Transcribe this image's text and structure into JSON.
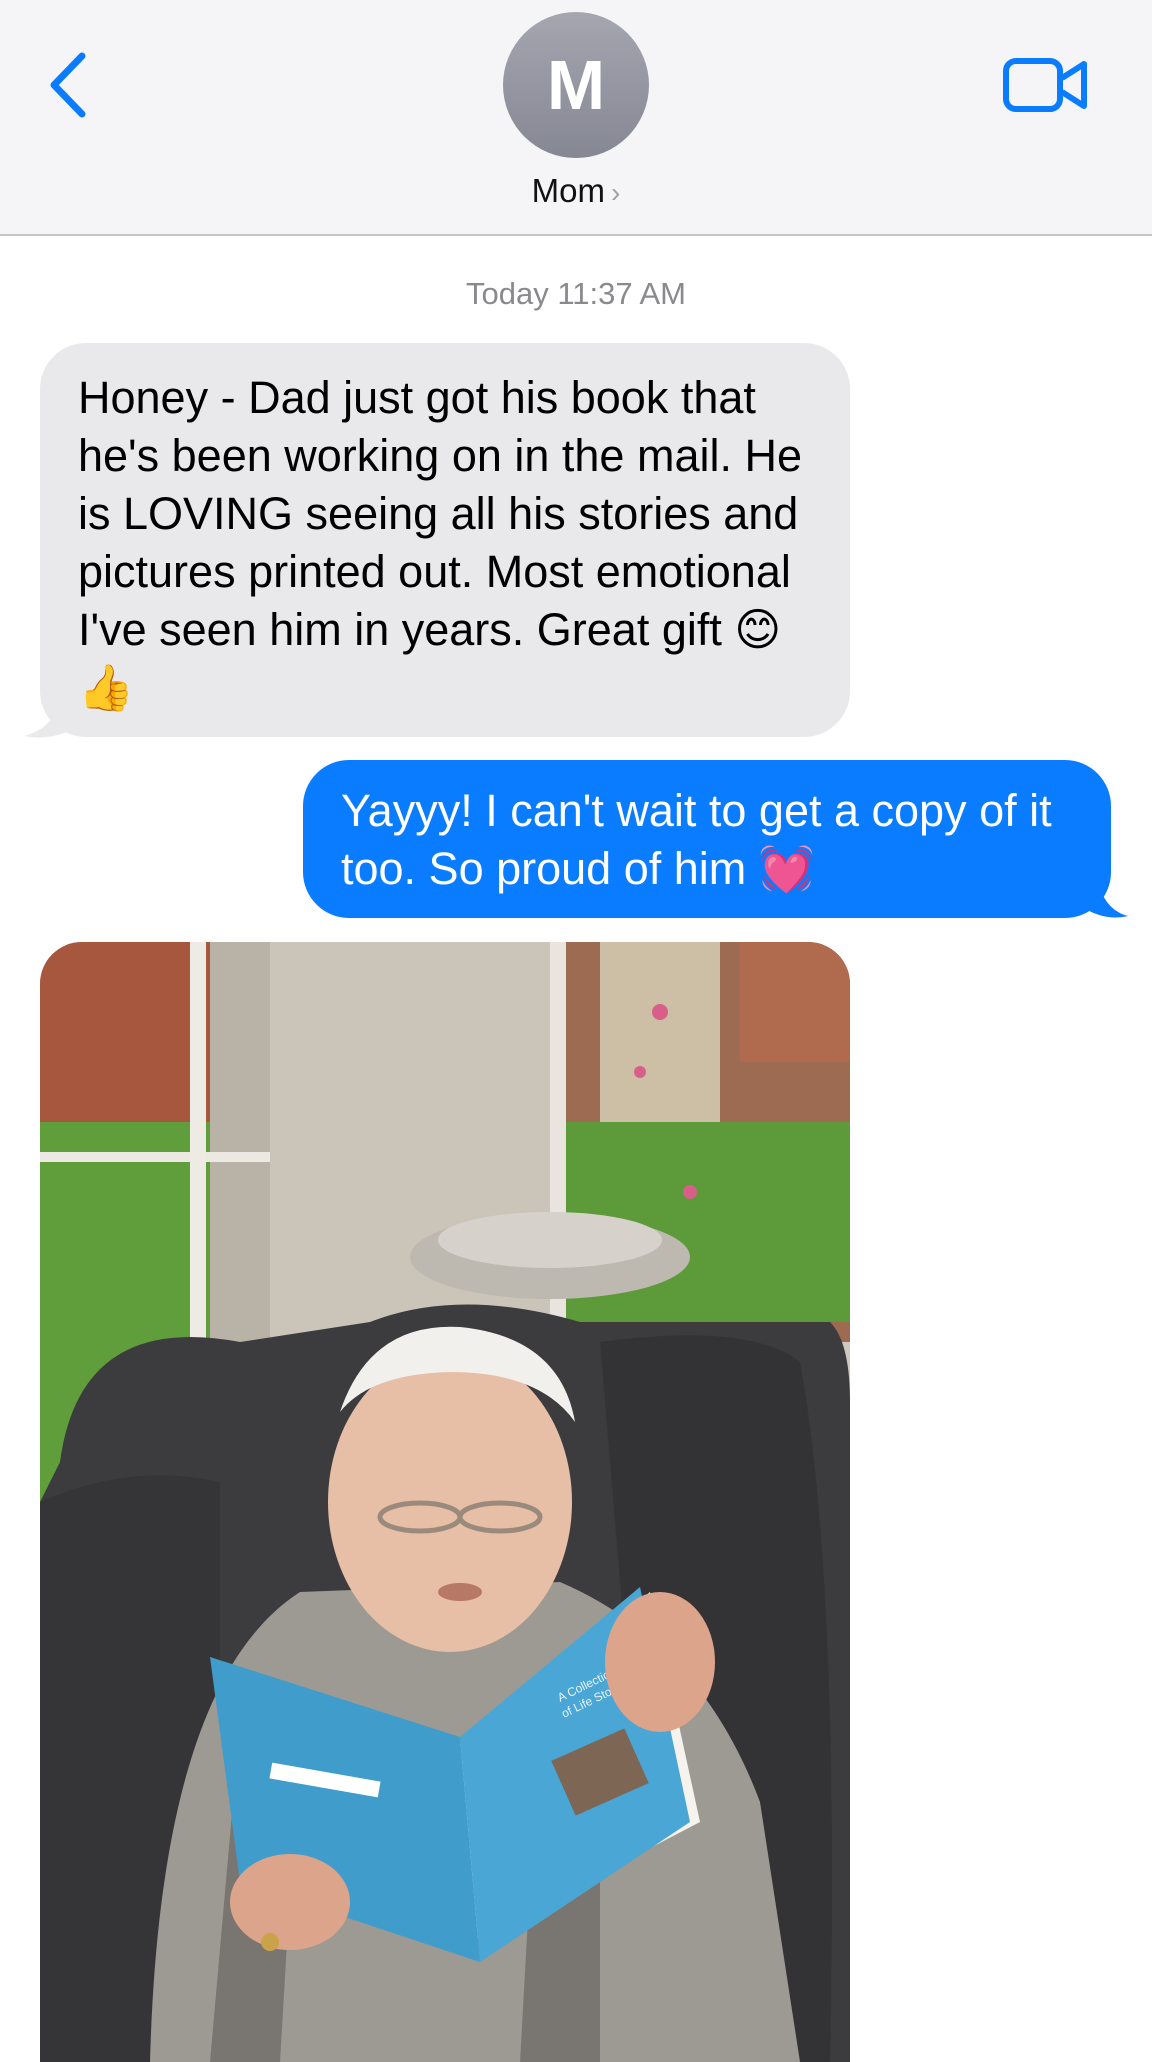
{
  "header": {
    "avatar_initial": "M",
    "contact_name": "Mom",
    "contact_chevron": "›",
    "back_icon": "chevron-left-icon",
    "video_icon": "video-camera-icon",
    "accent_color": "#0a7cff"
  },
  "thread": {
    "timestamp": "Today 11:37 AM",
    "messages": [
      {
        "direction": "incoming",
        "text": "Honey - Dad just got his book that he's been working on in the mail. He is LOVING seeing all his stories and pictures printed out. Most emotional I've seen him in years. Great gift 😊👍"
      },
      {
        "direction": "outgoing",
        "text": "Yayyy! I can't wait to get a copy of it too. So proud of him 💓"
      },
      {
        "direction": "incoming",
        "type": "photo",
        "photo_text": {
          "book_title": "A Collection of Life Stories"
        }
      }
    ]
  }
}
